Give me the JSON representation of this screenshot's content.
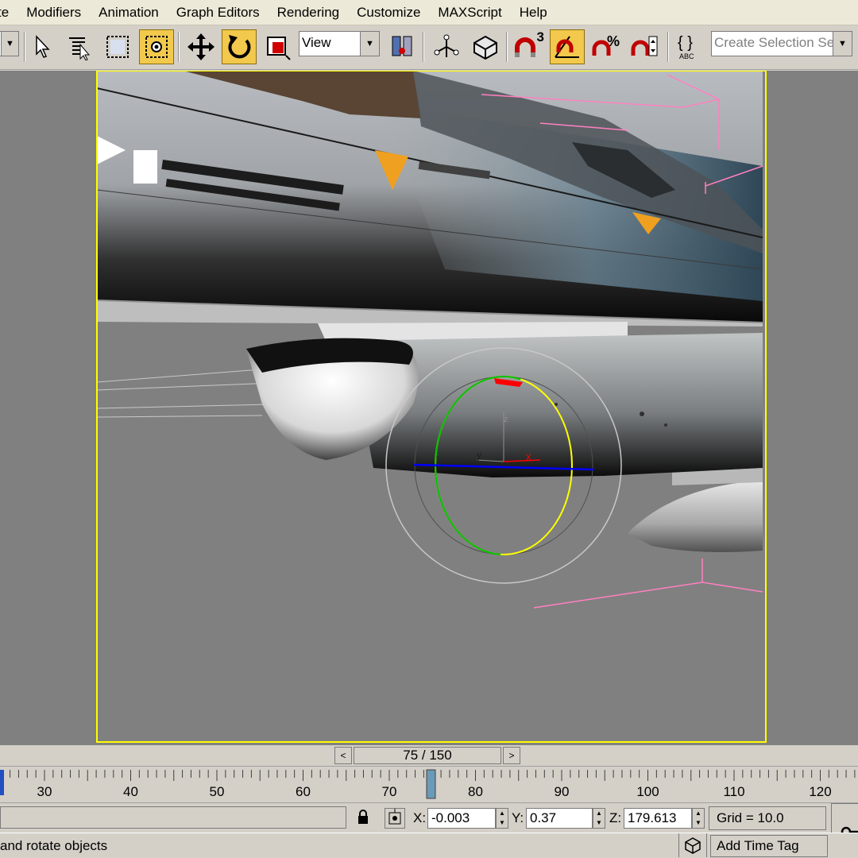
{
  "menubar": {
    "items": [
      "te",
      "Modifiers",
      "Animation",
      "Graph Editors",
      "Rendering",
      "Customize",
      "MAXScript",
      "Help"
    ]
  },
  "toolbar": {
    "icons": [
      "dropdown-arrow",
      "select-arrow",
      "select-by-name",
      "rectangular-selection",
      "window-crossing",
      "select-and-move",
      "select-and-rotate",
      "select-and-scale",
      "reference-coord",
      "use-pivot-center",
      "select-and-manipulate",
      "keyboard-shortcut-override",
      "snaps-toggle-3",
      "angle-snap-toggle",
      "percent-snap",
      "spinner-snap",
      "edit-named-selection"
    ],
    "reference_coordinate": "View",
    "snap_label": "3",
    "named_selection_placeholder": "Create Selection Set",
    "active_tools": [
      "window-crossing",
      "select-and-rotate",
      "angle-snap-toggle"
    ],
    "accent_color": "#f2c94c"
  },
  "viewport": {
    "border_color": "#ffff00",
    "background": "#808080",
    "gizmo_axis_labels": {
      "x": "x",
      "y": "y",
      "z": "z"
    },
    "gizmo_colors": {
      "x_ring": "#ffff00",
      "y_ring": "#00c000",
      "z_axis": "#0000ff",
      "screen_ring": "#c8c8c8",
      "trajectory": "#ff80c0"
    }
  },
  "time_slider": {
    "frame_label": "75 / 150",
    "current_frame": 75,
    "total_frames": 150,
    "prev_icon": "chevron-left-icon",
    "next_icon": "chevron-right-icon"
  },
  "trackbar": {
    "tick_labels": [
      "30",
      "40",
      "50",
      "60",
      "70",
      "80",
      "90",
      "100",
      "110",
      "120"
    ],
    "first_tick": 30,
    "last_tick": 120,
    "current_frame": 75
  },
  "status": {
    "prompt": "and rotate objects",
    "x_label": "X:",
    "x_value": "-0.003",
    "y_label": "Y:",
    "y_value": "0.37",
    "z_label": "Z:",
    "z_value": "179.613",
    "grid": "Grid = 10.0",
    "add_time_tag": "Add Time Tag"
  }
}
